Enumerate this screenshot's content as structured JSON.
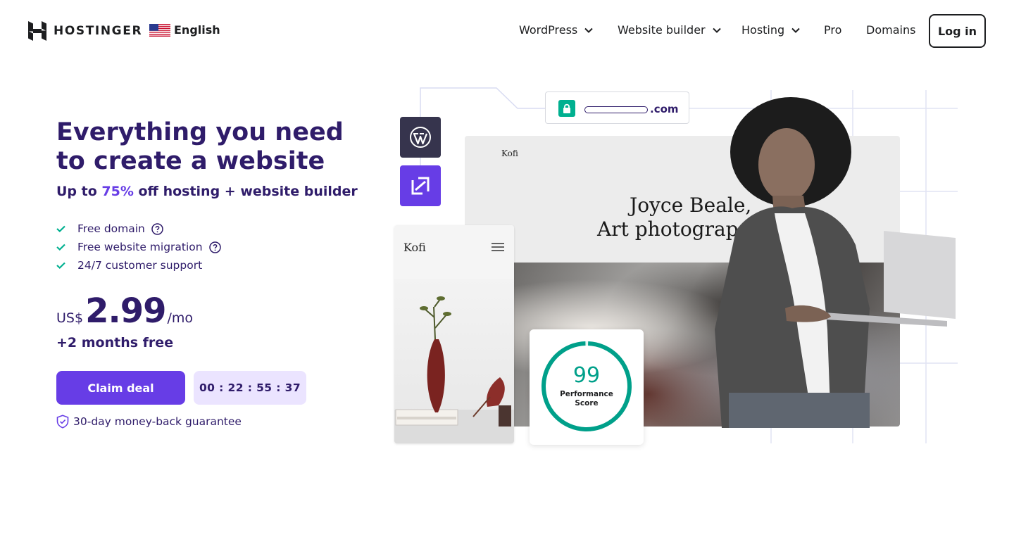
{
  "header": {
    "logo_text": "HOSTINGER",
    "language": "English",
    "nav": [
      {
        "label": "WordPress",
        "has_dropdown": true
      },
      {
        "label": "Website builder",
        "has_dropdown": true
      },
      {
        "label": "Hosting",
        "has_dropdown": true
      },
      {
        "label": "Pro",
        "has_dropdown": false
      },
      {
        "label": "Domains",
        "has_dropdown": false
      }
    ],
    "login_label": "Log in"
  },
  "hero": {
    "title": "Everything you need to create a website",
    "subtitle_prefix": "Up to ",
    "subtitle_accent": "75%",
    "subtitle_suffix": " off hosting + website builder",
    "features": [
      {
        "label": "Free domain",
        "has_help": true
      },
      {
        "label": "Free website migration",
        "has_help": true
      },
      {
        "label": "24/7 customer support",
        "has_help": false
      }
    ],
    "price": {
      "currency": "US$",
      "amount": "2.99",
      "period": "/mo"
    },
    "bonus": "+2 months free",
    "cta_label": "Claim deal",
    "timer": "00 : 22 : 55 : 37",
    "guarantee": "30-day money-back guarantee"
  },
  "illustration": {
    "url_tld": ".com",
    "desktop_brand": "Kofi",
    "desktop_title_line1": "Joyce Beale,",
    "desktop_title_line2": "Art photograp",
    "mobile_brand": "Kofi",
    "performance_score": "99",
    "performance_label_line1": "Performance",
    "performance_label_line2": "Score"
  },
  "colors": {
    "brand_purple": "#673de6",
    "heading_navy": "#2f1c6a",
    "check_green": "#00b090",
    "timer_bg": "#ebe4ff"
  },
  "icons": [
    "hostinger-logo-icon",
    "us-flag-icon",
    "chevron-down-icon",
    "check-icon",
    "help-circle-icon",
    "shield-check-icon",
    "lock-icon",
    "wordpress-icon",
    "website-builder-icon",
    "hamburger-menu-icon"
  ]
}
